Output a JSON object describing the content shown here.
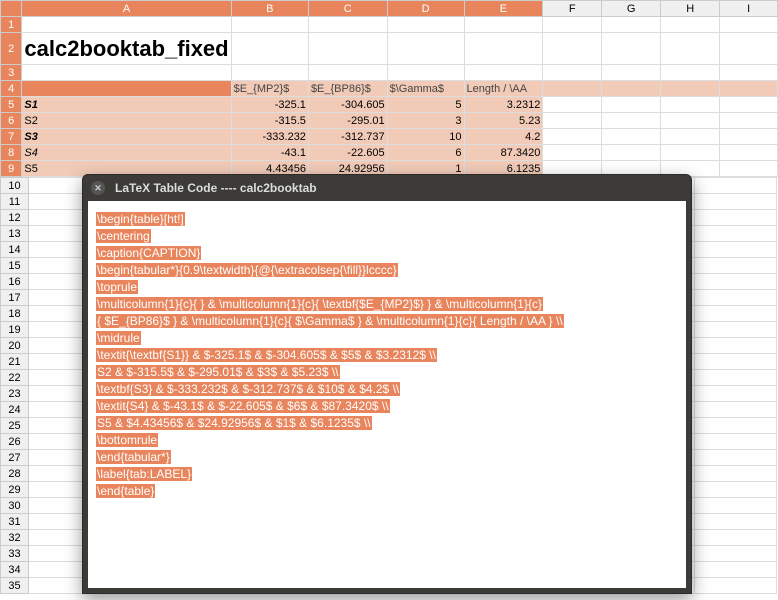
{
  "columns": [
    "A",
    "B",
    "C",
    "D",
    "E",
    "F",
    "G",
    "H",
    "I"
  ],
  "title": "calc2booktab_fixed",
  "headers": [
    "",
    "$E_{MP2}$",
    "$E_{BP86}$",
    "$\\Gamma$",
    "Length / \\AA"
  ],
  "rows": [
    {
      "label": "S1",
      "style": "bi",
      "b": "-325.1",
      "c": "-304.605",
      "d": "5",
      "e": "3.2312"
    },
    {
      "label": "S2",
      "style": "",
      "b": "-315.5",
      "c": "-295.01",
      "d": "3",
      "e": "5.23"
    },
    {
      "label": "S3",
      "style": "bi",
      "b": "-333.232",
      "c": "-312.737",
      "d": "10",
      "e": "4.2"
    },
    {
      "label": "S4",
      "style": "it",
      "b": "-43.1",
      "c": "-22.605",
      "d": "6",
      "e": "87.3420"
    },
    {
      "label": "S5",
      "style": "",
      "b": "4.43456",
      "c": "24.92956",
      "d": "1",
      "e": "6.1235"
    }
  ],
  "chart_data": {
    "type": "table",
    "columns": [
      "",
      "$E_{MP2}$",
      "$E_{BP86}$",
      "$\\Gamma$",
      "Length / \\AA"
    ],
    "rows": [
      [
        "S1",
        -325.1,
        -304.605,
        5,
        3.2312
      ],
      [
        "S2",
        -315.5,
        -295.01,
        3,
        5.23
      ],
      [
        "S3",
        -333.232,
        -312.737,
        10,
        4.2
      ],
      [
        "S4",
        -43.1,
        -22.605,
        6,
        87.342
      ],
      [
        "S5",
        4.43456,
        24.92956,
        1,
        6.1235
      ]
    ]
  },
  "dialog": {
    "title": "LaTeX Table Code ---- calc2booktab",
    "lines": [
      "\\begin{table}[ht!]",
      "\\centering",
      "\\caption{CAPTION}",
      "\\begin{tabular*}{0.9\\textwidth}{@{\\extracolsep{\\fill}}lcccc}",
      "\\toprule",
      "\\multicolumn{1}{c}{  } & \\multicolumn{1}{c}{ \\textbf{$E_{MP2}$} } & \\multicolumn{1}{c}",
      "{ $E_{BP86}$ } & \\multicolumn{1}{c}{ $\\Gamma$ } & \\multicolumn{1}{c}{ Length / \\AA } \\\\",
      "\\midrule",
      "\\textit{\\textbf{S1}} & $-325.1$ & $-304.605$ & $5$ & $3.2312$ \\\\",
      "S2 & $-315.5$ & $-295.01$ & $3$ & $5.23$ \\\\",
      "\\textbf{S3} & $-333.232$ & $-312.737$ & $10$ & $4.2$ \\\\",
      "\\textit{S4} & $-43.1$ & $-22.605$ & $6$ & $87.3420$ \\\\",
      "S5 & $4.43456$ & $24.92956$ & $1$ & $6.1235$ \\\\",
      "\\bottomrule",
      "\\end{tabular*}",
      "\\label{tab:LABEL}",
      "\\end{table}"
    ]
  }
}
